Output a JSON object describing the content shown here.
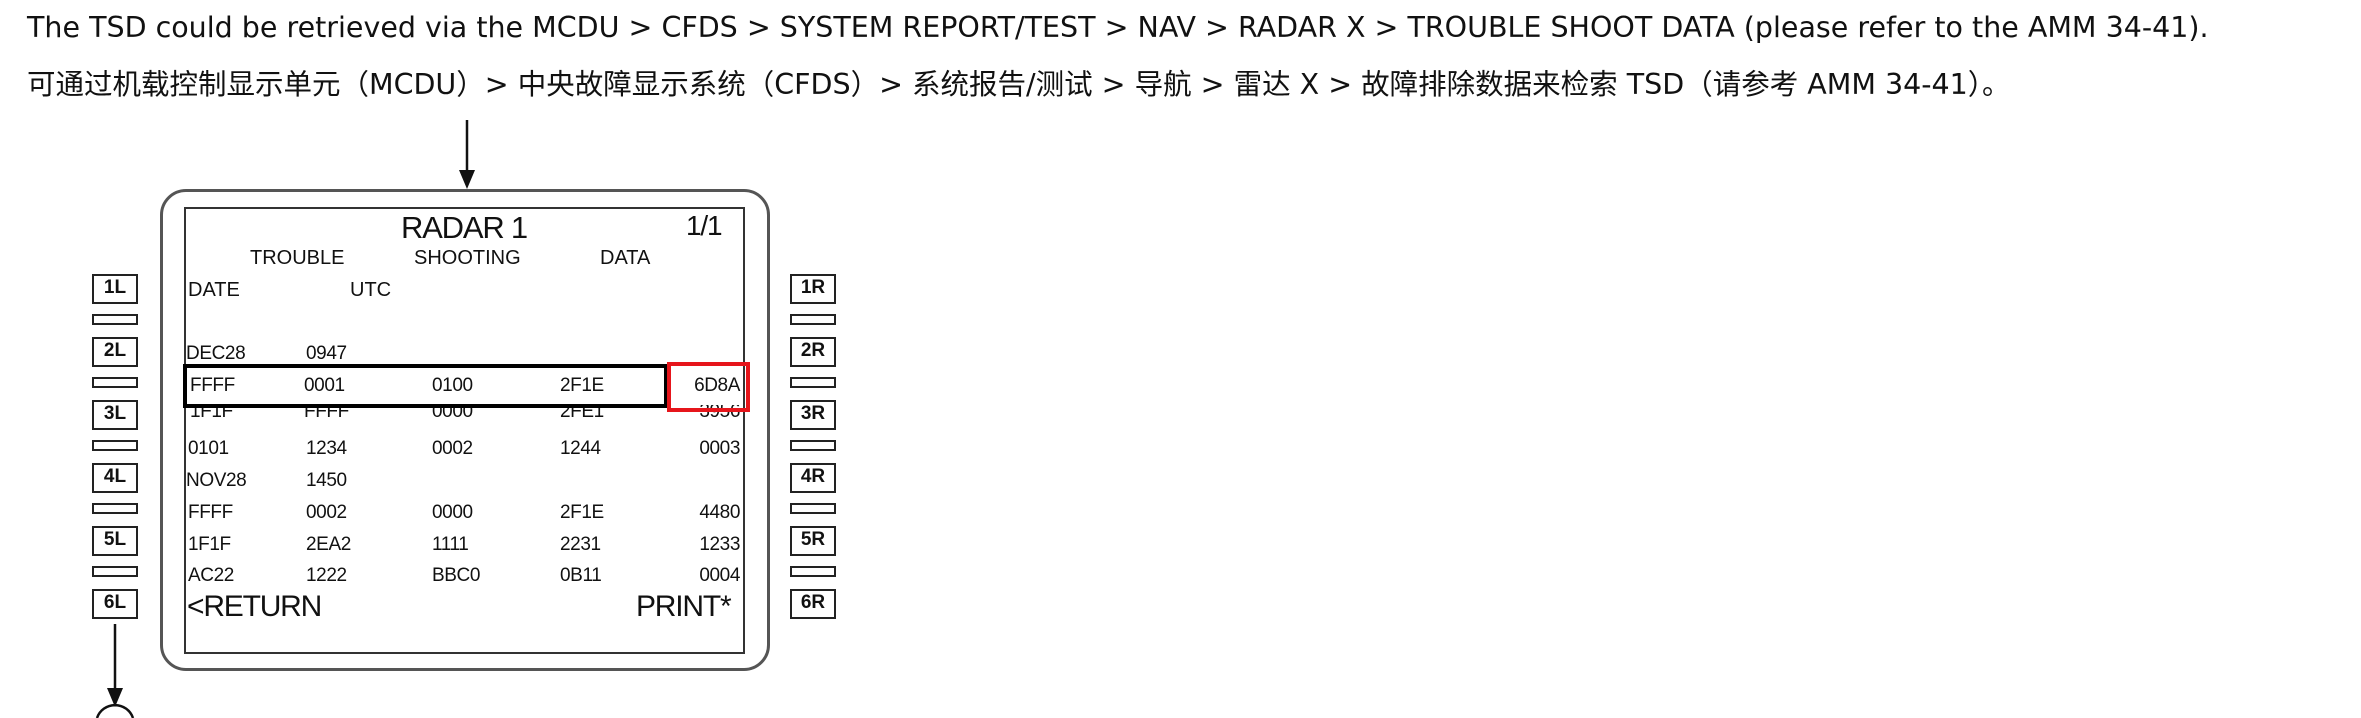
{
  "instructions": {
    "english": "The TSD could be retrieved via the MCDU > CFDS > SYSTEM REPORT/TEST > NAV > RADAR X > TROUBLE SHOOT DATA (please refer to the AMM 34-41).",
    "chinese": "可通过机载控制显示单元（MCDU）> 中央故障显示系统（CFDS）> 系统报告/测试 > 导航 > 雷达 X > 故障排除数据来检索 TSD（请参考 AMM 34-41）。"
  },
  "mcdu": {
    "title": "RADAR 1",
    "page": "1/1",
    "subtitle": {
      "trouble": "TROUBLE",
      "shooting": "SHOOTING",
      "data": "DATA"
    },
    "columns": {
      "date": "DATE",
      "utc": "UTC"
    },
    "blocks": [
      {
        "date": "DEC28",
        "utc": "0947",
        "rows": [
          [
            "FFFF",
            "0001",
            "0100",
            "2F1E",
            "6D8A"
          ],
          [
            "1F1F",
            "FFFF",
            "0000",
            "2FE1",
            "3956"
          ],
          [
            "0101",
            "1234",
            "0002",
            "1244",
            "0003"
          ]
        ]
      },
      {
        "date": "NOV28",
        "utc": "1450",
        "rows": [
          [
            "FFFF",
            "0002",
            "0000",
            "2F1E",
            "4480"
          ],
          [
            "1F1F",
            "2EA2",
            "1111",
            "2231",
            "1233"
          ],
          [
            "AC22",
            "1222",
            "BBC0",
            "0B11",
            "0004"
          ]
        ]
      }
    ],
    "return_label": "<RETURN",
    "print_label": "PRINT*",
    "left_keys": [
      "1L",
      "2L",
      "3L",
      "4L",
      "5L",
      "6L"
    ],
    "right_keys": [
      "1R",
      "2R",
      "3R",
      "4R",
      "5R",
      "6R"
    ],
    "highlight_color_row": "#000000",
    "highlight_color_cell": "#e6151b"
  }
}
